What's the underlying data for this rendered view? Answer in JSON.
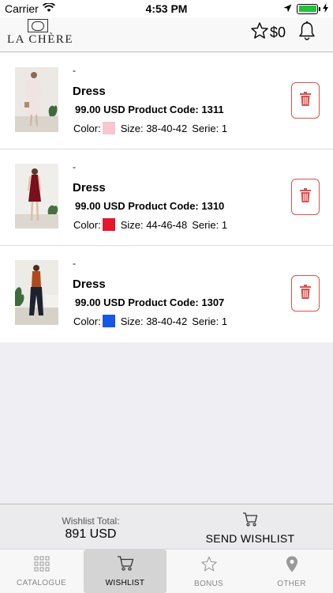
{
  "status_bar": {
    "carrier": "Carrier",
    "time": "4:53 PM"
  },
  "header": {
    "logo_text": "LA CHÈRE",
    "balance": "$0"
  },
  "items": [
    {
      "dash": "-",
      "name": "Dress",
      "price_line": "99.00 USD Product Code: 1311",
      "color_label": "Color:",
      "color": "#f7c6d0",
      "size": "Size: 38-40-42",
      "serie": "Serie: 1",
      "image": "model-photo-light-dress"
    },
    {
      "dash": "-",
      "name": "Dress",
      "price_line": "99.00 USD Product Code: 1310",
      "color_label": "Color:",
      "color": "#e3182d",
      "size": "Size: 44-46-48",
      "serie": "Serie: 1",
      "image": "model-photo-red-dress"
    },
    {
      "dash": "-",
      "name": "Dress",
      "price_line": "99.00 USD Product Code: 1307",
      "color_label": "Color:",
      "color": "#1857e6",
      "size": "Size: 38-40-42",
      "serie": "Serie: 1",
      "image": "model-photo-orange-top"
    }
  ],
  "summary": {
    "total_label": "Wishlist Total:",
    "total_value": "891 USD",
    "send_label": "SEND WISHLIST"
  },
  "tabs": [
    {
      "label": "CATALOGUE",
      "icon": "grid-icon",
      "active": false
    },
    {
      "label": "WISHLIST",
      "icon": "cart-icon",
      "active": true
    },
    {
      "label": "BONUS",
      "icon": "star-icon",
      "active": false
    },
    {
      "label": "OTHER",
      "icon": "location-pin-icon",
      "active": false
    }
  ],
  "colors": {
    "delete_red": "#d9534f",
    "battery_green": "#22c23a"
  }
}
